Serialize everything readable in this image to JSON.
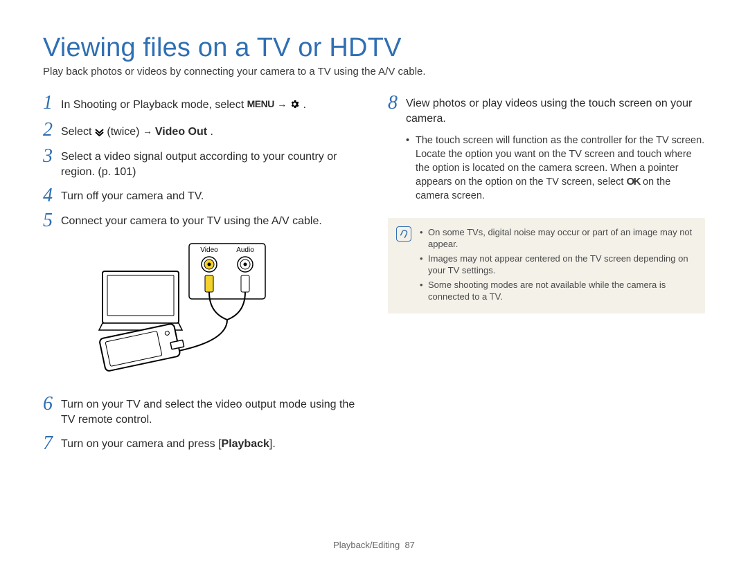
{
  "title": "Viewing files on a TV or HDTV",
  "intro": "Play back photos or videos by connecting your camera to a TV using the A/V cable.",
  "steps_left": {
    "s1_pre": "In Shooting or Playback mode, select ",
    "s1_menu": "MENU",
    "s1_post": ".",
    "s2_pre": "Select ",
    "s2_mid": " (twice) ",
    "s2_bold": "Video Out",
    "s2_post": ".",
    "s3": "Select a video signal output according to your country or region. (p. 101)",
    "s4": "Turn off your camera and TV.",
    "s5": "Connect your camera to your TV using the A/V cable.",
    "s6": "Turn on your TV and select the video output mode using the TV remote control.",
    "s7_pre": "Turn on your camera and press [",
    "s7_bold": "Playback",
    "s7_post": "]."
  },
  "diagram": {
    "video_label": "Video",
    "audio_label": "Audio"
  },
  "steps_right": {
    "s8": "View photos or play videos using the touch screen on your camera.",
    "s8_bullet_pre": "The touch screen will function as the controller for the TV screen. Locate the option you want on the TV screen and touch where the option is located on the camera screen. When a pointer appears on the option on the TV screen, select ",
    "s8_ok": "OK",
    "s8_bullet_post": " on the camera screen."
  },
  "notes": {
    "n1": "On some TVs, digital noise may occur or part of an image may not appear.",
    "n2": "Images may not appear centered on the TV screen depending on your TV settings.",
    "n3": "Some shooting modes are not available while the camera is connected to a TV."
  },
  "footer": {
    "section": "Playback/Editing",
    "page": "87"
  }
}
